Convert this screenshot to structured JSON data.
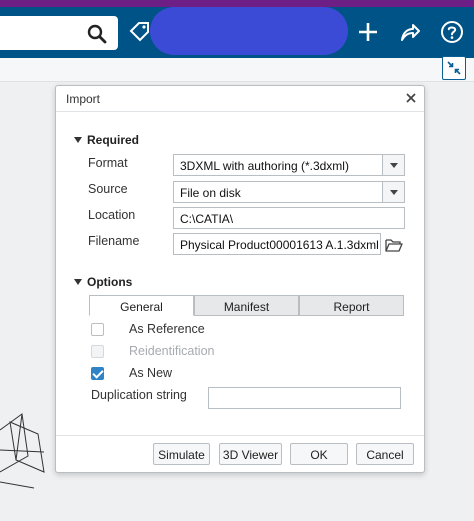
{
  "colors": {
    "topbar": "#005386",
    "accent": "#6e1f85",
    "check": "#2e84c7"
  },
  "icons": [
    "search-icon",
    "tag-icon",
    "plus-icon",
    "share-icon",
    "help-icon",
    "collapse-icon",
    "close-icon",
    "folder-icon"
  ],
  "dialog": {
    "title": "Import",
    "required": {
      "heading": "Required",
      "format": {
        "label": "Format",
        "value": "3DXML with authoring (*.3dxml)"
      },
      "source": {
        "label": "Source",
        "value": "File on disk"
      },
      "location": {
        "label": "Location",
        "value": "C:\\CATIA\\"
      },
      "filename": {
        "label": "Filename",
        "value": "Physical Product00001613 A.1.3dxml"
      }
    },
    "options": {
      "heading": "Options",
      "tabs": [
        "General",
        "Manifest",
        "Report"
      ],
      "as_reference": {
        "label": "As Reference",
        "checked": false
      },
      "reidentification": {
        "label": "Reidentification",
        "checked": false,
        "disabled": true
      },
      "as_new": {
        "label": "As New",
        "checked": true
      },
      "duplication_string": {
        "label": "Duplication string",
        "value": ""
      }
    },
    "buttons": {
      "simulate": "Simulate",
      "viewer": "3D Viewer",
      "ok": "OK",
      "cancel": "Cancel"
    }
  }
}
